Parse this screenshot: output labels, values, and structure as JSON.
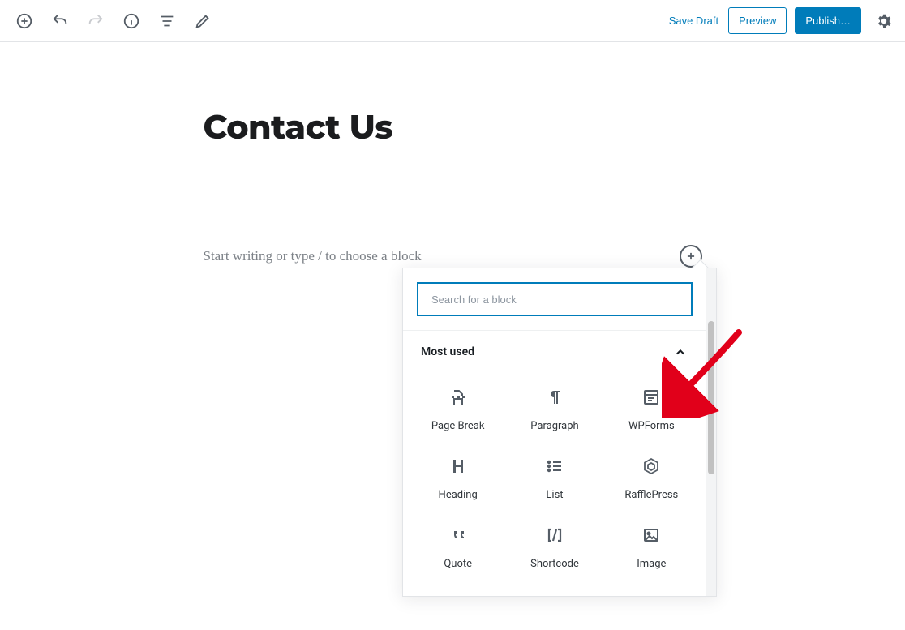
{
  "toolbar": {
    "save_draft_label": "Save Draft",
    "preview_label": "Preview",
    "publish_label": "Publish…"
  },
  "page": {
    "title": "Contact Us",
    "placeholder_text": "Start writing or type / to choose a block"
  },
  "inserter": {
    "search_placeholder": "Search for a block",
    "section_title": "Most used",
    "blocks": {
      "page_break": "Page Break",
      "paragraph": "Paragraph",
      "wpforms": "WPForms",
      "heading": "Heading",
      "list": "List",
      "rafflepress": "RafflePress",
      "quote": "Quote",
      "shortcode": "Shortcode",
      "image": "Image"
    }
  }
}
